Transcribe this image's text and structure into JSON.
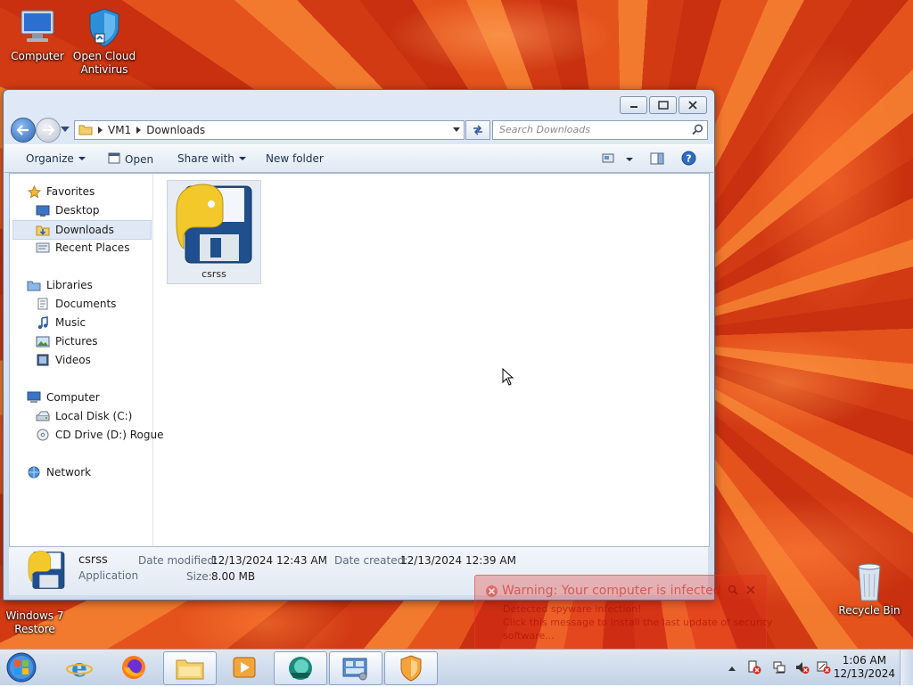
{
  "desktop": {
    "icons": [
      {
        "label": "Computer",
        "icon": "computer-icon"
      },
      {
        "label": "Open Cloud Antivirus",
        "icon": "shield-icon"
      },
      {
        "label": "Windows 7 Restore",
        "icon": "restore-icon"
      },
      {
        "label": "Recycle Bin",
        "icon": "recycle-bin-icon"
      }
    ]
  },
  "window": {
    "breadcrumb": [
      "VM1",
      "Downloads"
    ],
    "search_placeholder": "Search Downloads",
    "toolbar": {
      "organize": "Organize",
      "open": "Open",
      "share_with": "Share with",
      "new_folder": "New folder"
    },
    "nav": {
      "favorites": "Favorites",
      "desktop": "Desktop",
      "downloads": "Downloads",
      "recent_places": "Recent Places",
      "libraries": "Libraries",
      "documents": "Documents",
      "music": "Music",
      "pictures": "Pictures",
      "videos": "Videos",
      "computer": "Computer",
      "local_disk": "Local Disk (C:)",
      "cd_drive": "CD Drive (D:) Rogue",
      "network": "Network"
    },
    "files": [
      {
        "name": "csrss",
        "icon": "python-file-icon"
      }
    ],
    "details": {
      "name": "csrss",
      "type": "Application",
      "date_modified_label": "Date modified:",
      "date_modified": "12/13/2024 12:43 AM",
      "size_label": "Size:",
      "size": "8.00 MB",
      "date_created_label": "Date created:",
      "date_created": "12/13/2024 12:39 AM"
    }
  },
  "warning": {
    "title": "Warning: Your computer is infected",
    "line1": "Detected spyware infection!",
    "line2": "Click this message to install the last update of security",
    "line3": "software..."
  },
  "taskbar": {
    "apps": [
      "start-orb",
      "internet-explorer-icon",
      "firefox-icon",
      "file-explorer-icon",
      "media-player-icon",
      "browser-icon",
      "control-panel-icon",
      "antivirus-shield-icon"
    ],
    "clock_time": "1:06 AM",
    "clock_date": "12/13/2024"
  },
  "colors": {
    "accent": "#2d64b3",
    "warning": "#e1281e"
  }
}
